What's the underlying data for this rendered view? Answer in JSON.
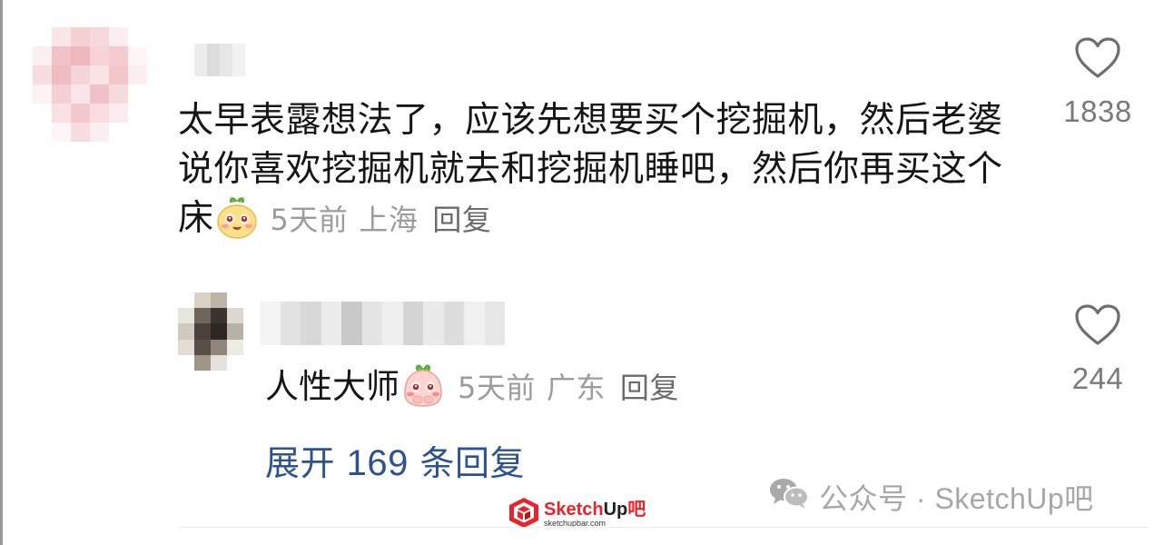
{
  "comment": {
    "text": "太早表露想法了，应该先想要买个挖掘机，然后老婆说你喜欢挖掘机就去和挖掘机睡吧，然后你再买这个床",
    "emoji_icon": "happy-face-emoji-icon",
    "time": "5天前",
    "location": "上海",
    "reply_label": "回复",
    "like_icon": "heart-outline-icon",
    "like_count": "1838"
  },
  "reply": {
    "text": "人性大师",
    "emoji_icon": "shy-face-emoji-icon",
    "time": "5天前",
    "location": "广东",
    "reply_label": "回复",
    "like_icon": "heart-outline-icon",
    "like_count": "244"
  },
  "expand_replies": {
    "prefix": "展开",
    "count": "169",
    "suffix": "条回复"
  },
  "watermark": {
    "icon": "wechat-icon",
    "text": "公众号 · SketchUp吧"
  },
  "logo": {
    "brand_red": "Sketch",
    "brand_dark": "Up",
    "brand_tail": "吧",
    "url": "sketchupbar.com"
  },
  "colors": {
    "text": "#151515",
    "meta_gray": "#9c9c9c",
    "link_blue": "#2d5293",
    "heart_gray": "#7a7a7a",
    "logo_red": "#e8232b"
  }
}
